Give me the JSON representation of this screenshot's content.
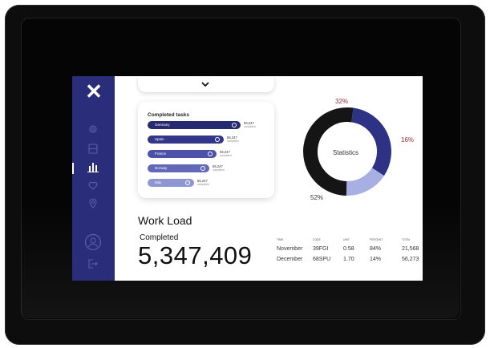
{
  "sidebar": {
    "close_glyph": "✕",
    "icons": [
      "gear-icon",
      "archive-icon",
      "bar-chart-icon",
      "heart-icon",
      "location-pin-icon",
      "user-icon",
      "logout-icon"
    ],
    "active": "bar-chart-icon",
    "bg_color": "#2a2e7a"
  },
  "tasks": {
    "title": "Completed tasks",
    "rows": [
      {
        "country": "Germany",
        "value": "56,247",
        "sub": "completed",
        "fill": 1.0,
        "color": "#262a6e"
      },
      {
        "country": "Spain",
        "value": "56,247",
        "sub": "completed",
        "fill": 0.82,
        "color": "#32378a"
      },
      {
        "country": "France",
        "value": "56,247",
        "sub": "completed",
        "fill": 0.74,
        "color": "#4b52a8"
      },
      {
        "country": "Norway",
        "value": "56,247",
        "sub": "completed",
        "fill": 0.66,
        "color": "#6168b8"
      },
      {
        "country": "Italy",
        "value": "56,247",
        "sub": "completed",
        "fill": 0.5,
        "color": "#8f97d2"
      }
    ]
  },
  "statistics": {
    "label": "Statistics",
    "segments": [
      {
        "percent": 32,
        "label": "32%",
        "color": "#2d3285"
      },
      {
        "percent": 16,
        "label": "16%",
        "color": "#a8b0e3"
      },
      {
        "percent": 52,
        "label": "52%",
        "color": "#151515"
      }
    ],
    "accent_label_color": "#9b2b3a"
  },
  "workload": {
    "title": "Work Load",
    "completed_label": "Completed",
    "completed_value": "5,347,409"
  },
  "table": {
    "headers": [
      "TIME",
      "CODE",
      "UNIT",
      "PERCENT",
      "TOTAL"
    ],
    "rows": [
      [
        "November",
        "39FGI",
        "0.58",
        "84%",
        "21,568"
      ],
      [
        "December",
        "68SPU",
        "1.70",
        "14%",
        "56,273"
      ]
    ]
  }
}
